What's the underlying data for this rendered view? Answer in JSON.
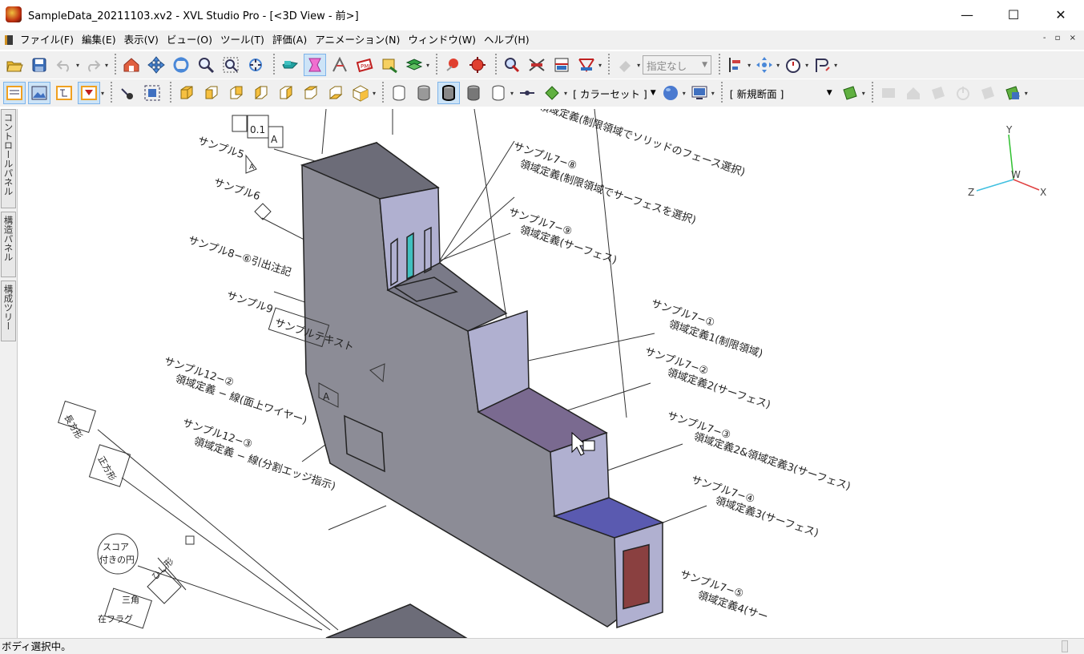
{
  "window": {
    "title": "SampleData_20211103.xv2 - XVL Studio Pro - [<3D View - 前>]",
    "minimize_glyph": "—",
    "maximize_glyph": "☐",
    "close_glyph": "✕"
  },
  "menu": {
    "items": [
      "ファイル(F)",
      "編集(E)",
      "表示(V)",
      "ビュー(O)",
      "ツール(T)",
      "評価(A)",
      "アニメーション(N)",
      "ウィンドウ(W)",
      "ヘルプ(H)"
    ],
    "mdi_controls": "- ▫ ×"
  },
  "toolbar1": {
    "icons": [
      "open-icon",
      "save-icon",
      "undo-icon",
      "redo-icon",
      "home-view-icon",
      "pan-icon",
      "rotate-icon",
      "zoom-icon",
      "zoom-window-icon",
      "zoom-fit-icon",
      "camera-icon",
      "select-mode-icon",
      "measure-icon",
      "markup-icon",
      "note-icon",
      "layer-icon",
      "sphere-icon",
      "explode-icon",
      "section-icon",
      "cross-section-icon",
      "interference-icon",
      "filter-icon"
    ],
    "filter_combo": "指定なし"
  },
  "toolbar2": {
    "color_set": "[ カラーセット ]",
    "section_combo": "[ 新規断面 ]"
  },
  "sidetabs": [
    "コントロールパネル",
    "構造パネル",
    "構成ツリー"
  ],
  "viewport": {
    "annotations": [
      "サンプル5",
      "サンプル6",
      "サンプル8−⑥引出注記",
      "サンプル9",
      "サンプルテキスト",
      "サンプル12−②",
      "領域定義 − 線(面上ワイヤー)",
      "サンプル12−③",
      "領域定義 − 線(分割エッジ指示)",
      "長方形",
      "正方形",
      "スコア",
      "付きの円",
      "ひし形",
      "三角",
      "在フラグ",
      "サンプル7−⑧",
      "領域定義(制限領域でサーフェスを選択)",
      "サンプル7−⑨",
      "領域定義(サーフェス)",
      "領域定義(制限領域でソリッドのフェース選択)",
      "サンプル7−①",
      "領域定義1(制限領域)",
      "サンプル7−②",
      "領域定義2(サーフェス)",
      "サンプル7−③",
      "領域定義2&領域定義3(サーフェス)",
      "サンプル7−④",
      "領域定義3(サーフェス)",
      "サンプル7−⑤",
      "領域定義4(サー",
      "0.1",
      "A",
      "A",
      "A"
    ],
    "axes": {
      "y": "Y",
      "w": "W",
      "z": "Z",
      "x": "X"
    }
  },
  "status": {
    "text": "ボディ選択中。"
  },
  "colors": {
    "body_face": "#8c8c96",
    "top_face": "#6c6c78",
    "right_face": "#b0b0d0",
    "axis_y": "#30c030",
    "axis_z": "#40c0e0",
    "axis_x": "#e04040"
  }
}
